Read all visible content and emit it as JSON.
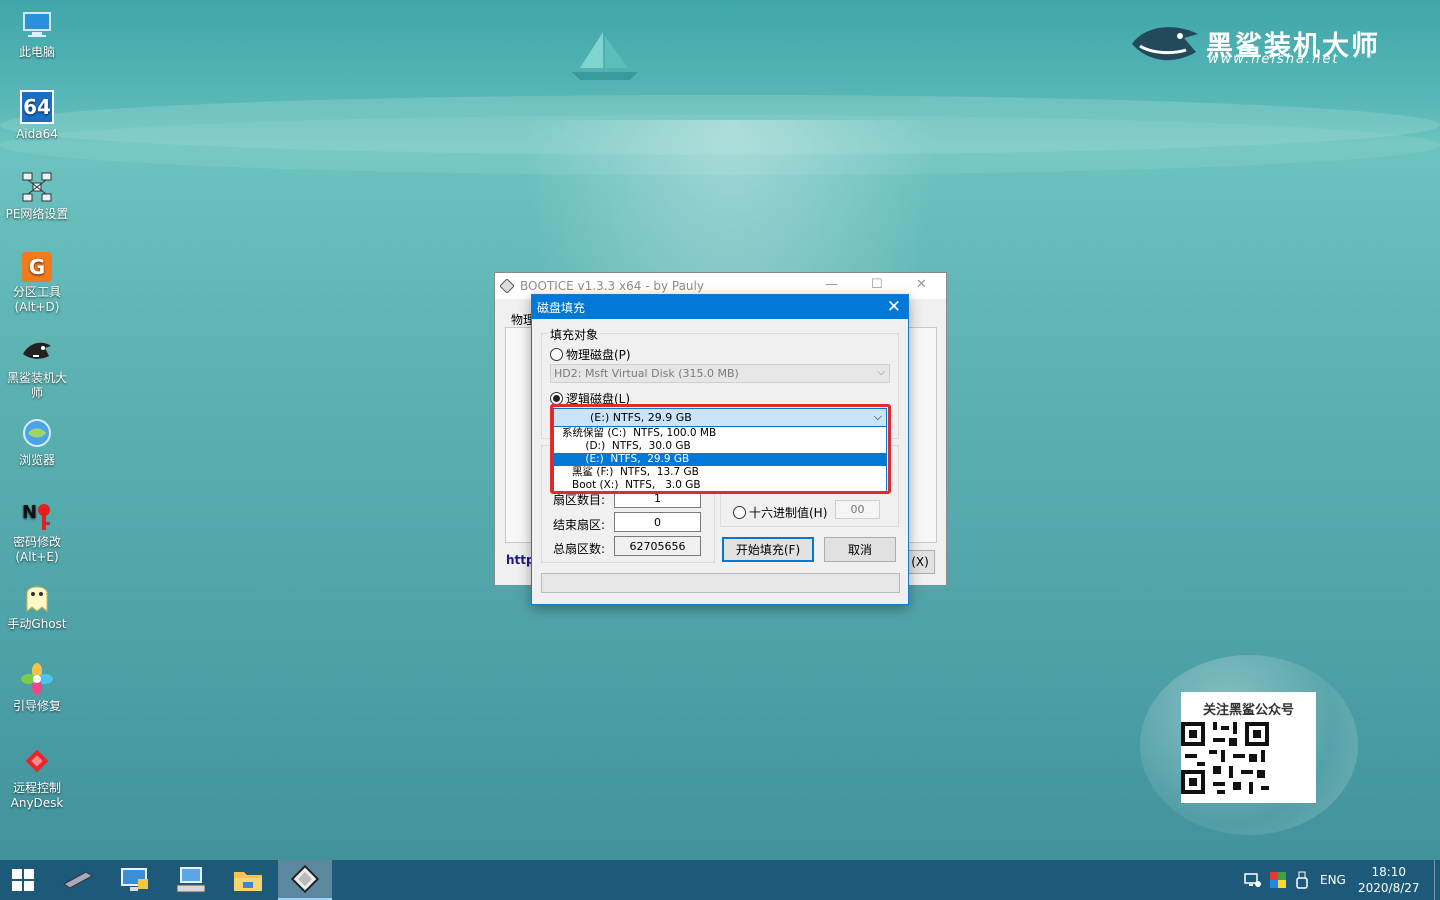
{
  "desktop": {
    "icons": [
      {
        "label": "此电脑",
        "icon": "computer-icon"
      },
      {
        "label": "Aida64",
        "icon": "aida64-icon"
      },
      {
        "label": "PE网络设置",
        "icon": "network-icon"
      },
      {
        "label": "分区工具\n(Alt+D)",
        "icon": "partition-tool-icon"
      },
      {
        "label": "黑鲨装机大\n师",
        "icon": "shark-icon"
      },
      {
        "label": "浏览器",
        "icon": "browser-icon"
      },
      {
        "label": "密码修改\n(Alt+E)",
        "icon": "password-icon"
      },
      {
        "label": "手动Ghost",
        "icon": "ghost-icon"
      },
      {
        "label": "引导修复",
        "icon": "boot-repair-icon"
      },
      {
        "label": "远程控制\nAnyDesk",
        "icon": "anydesk-icon"
      }
    ]
  },
  "brand": {
    "name": "黑鲨装机大师",
    "url": "www.heisha.net",
    "qr_title": "关注黑鲨公众号"
  },
  "bootice": {
    "title": "BOOTICE v1.3.3 x64 - by Pauly",
    "tab_partial": "物理",
    "link_partial": "http",
    "exit_partial": "(X)"
  },
  "dialog": {
    "title": "磁盘填充",
    "group_label": "填充对象",
    "physical_radio": "物理磁盘(P)",
    "physical_combo": "HD2: Msft Virtual Disk (315.0 MB)",
    "logical_radio": "逻辑磁盘(L)",
    "logical_selected": "(E:)  NTFS,  29.9 GB",
    "dropdown_options": [
      "系统保留 (C:)  NTFS, 100.0 MB",
      "       (D:)  NTFS,  30.0 GB",
      "       (E:)  NTFS,  29.9 GB",
      "   黑鲨 (F:)  NTFS,  13.7 GB",
      "   Boot (X:)  NTFS,   3.0 GB"
    ],
    "highlighted_option": 2,
    "sector_count_label": "扇区数目:",
    "sector_count_value": "1",
    "end_sector_label": "结束扇区:",
    "end_sector_value": "0",
    "total_sectors_label": "总扇区数:",
    "total_sectors_value": "62705656",
    "hex_radio": "十六进制值(H)",
    "hex_value": "00",
    "start_button": "开始填充(F)",
    "cancel_button": "取消"
  },
  "taskbar": {
    "language": "ENG",
    "time": "18:10",
    "date": "2020/8/27"
  }
}
